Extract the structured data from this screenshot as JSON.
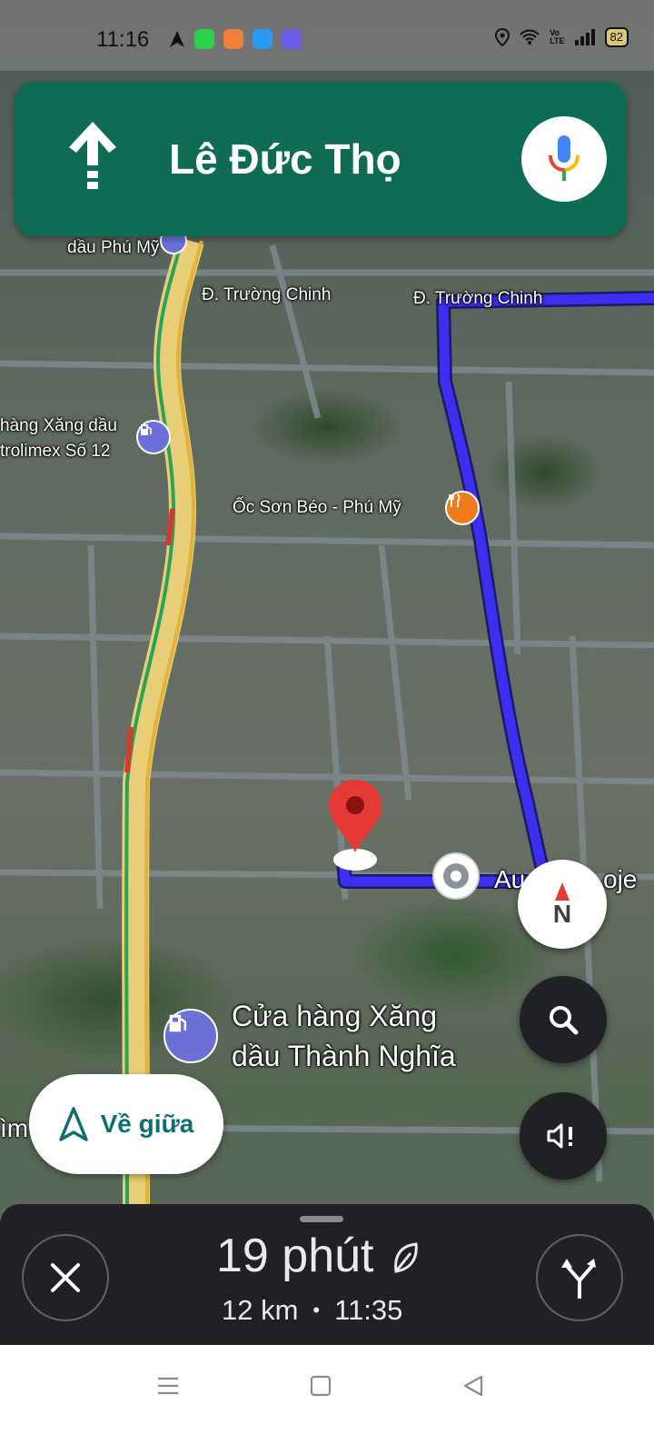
{
  "status_bar": {
    "time": "11:16",
    "battery": "82",
    "network_label": "Vo\nLTE"
  },
  "navigation": {
    "street": "Lê Đức Thọ",
    "direction_icon": "straight-arrow-icon"
  },
  "map_labels": {
    "top_left_poi": "dầu Phú Mỹ",
    "road_1": "Đ. Trường Chinh",
    "road_2": "Đ. Trường Chinh",
    "gas_station_1_line1": "hàng Xăng dầu",
    "gas_station_1_line2": "trolimex Số 12",
    "restaurant": "Ốc Sơn Béo - Phú Mỹ",
    "destination_partial": "Au",
    "destination_partial_2": "oje",
    "gas_station_2_line1": "Cửa hàng Xăng",
    "gas_station_2_line2": "dầu Thành Nghĩa",
    "left_edge_text": "ìm"
  },
  "controls": {
    "compass_label": "N",
    "recenter_label": "Về giữa"
  },
  "trip": {
    "duration": "19 phút",
    "distance": "12 km",
    "separator": "•",
    "arrival": "11:35"
  },
  "colors": {
    "nav_green": "#0f6b53",
    "route_blue": "#3d2ef0",
    "sheet_dark": "#202124",
    "recenter_teal": "#0d6f70"
  }
}
